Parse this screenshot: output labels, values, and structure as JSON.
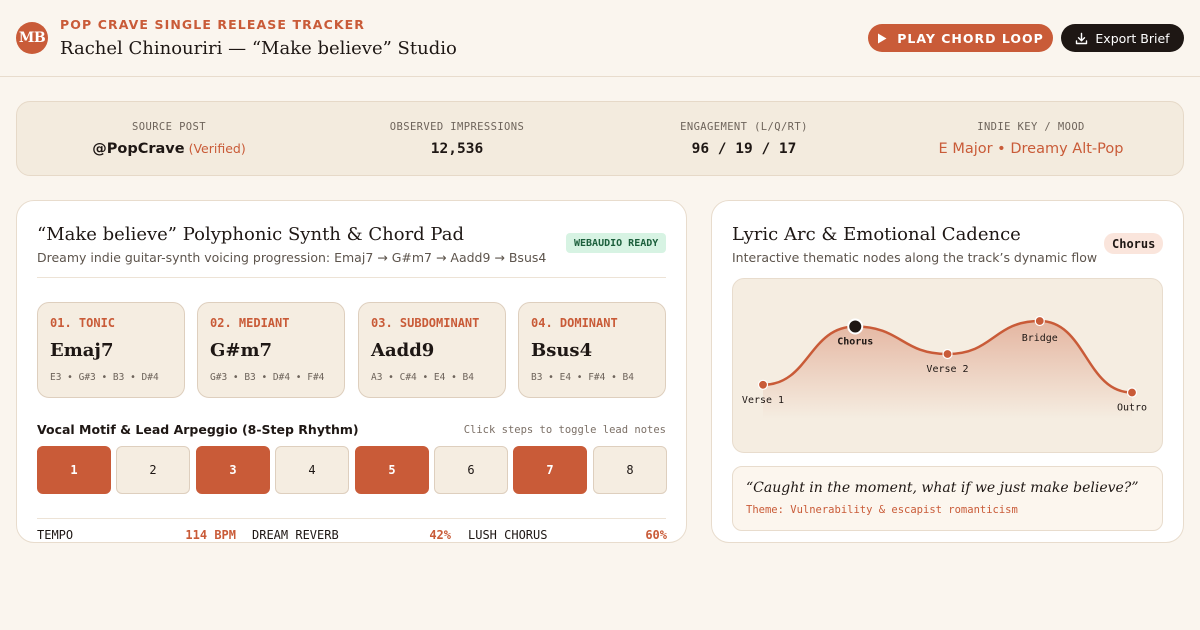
{
  "header": {
    "logo": "MB",
    "eyebrow": "POP CRAVE SINGLE RELEASE TRACKER",
    "title": "Rachel Chinouriri — “Make believe” Studio",
    "play_label": "PLAY CHORD LOOP",
    "play_icon": "play-icon",
    "export_label": "Export Brief",
    "export_icon": "download-icon"
  },
  "stats": [
    {
      "label": "SOURCE POST",
      "value": "@PopCrave",
      "extra": "(Verified)"
    },
    {
      "label": "OBSERVED IMPRESSIONS",
      "value": "12,536"
    },
    {
      "label": "ENGAGEMENT (L/Q/RT)",
      "value": "96 / 19 / 17"
    },
    {
      "label": "INDIE KEY / MOOD",
      "value": "E Major • Dreamy Alt-Pop"
    }
  ],
  "synth": {
    "title": "“Make believe” Polyphonic Synth & Chord Pad",
    "subtitle": "Dreamy indie guitar-synth voicing progression: Emaj7 → G#m7 → Aadd9 → Bsus4",
    "badge": "WEBAUDIO READY",
    "chords": [
      {
        "role": "01. TONIC",
        "name": "Emaj7",
        "notes": "E3 • G#3 • B3 • D#4"
      },
      {
        "role": "02. MEDIANT",
        "name": "G#m7",
        "notes": "G#3 • B3 • D#4 • F#4"
      },
      {
        "role": "03. SUBDOMINANT",
        "name": "Aadd9",
        "notes": "A3 • C#4 • E4 • B4"
      },
      {
        "role": "04. DOMINANT",
        "name": "Bsus4",
        "notes": "B3 • E4 • F#4 • B4"
      }
    ],
    "sequencer": {
      "title": "Vocal Motif & Lead Arpeggio (8-Step Rhythm)",
      "hint": "Click steps to toggle lead notes",
      "steps": [
        {
          "label": "1",
          "active": true
        },
        {
          "label": "2",
          "active": false
        },
        {
          "label": "3",
          "active": true
        },
        {
          "label": "4",
          "active": false
        },
        {
          "label": "5",
          "active": true
        },
        {
          "label": "6",
          "active": false
        },
        {
          "label": "7",
          "active": true
        },
        {
          "label": "8",
          "active": false
        }
      ]
    },
    "params": [
      {
        "label": "TEMPO",
        "value": "114 BPM"
      },
      {
        "label": "DREAM REVERB",
        "value": "42%"
      },
      {
        "label": "LUSH CHORUS",
        "value": "60%"
      }
    ]
  },
  "lyric": {
    "title": "Lyric Arc & Emotional Cadence",
    "subtitle": "Interactive thematic nodes along the track’s dynamic flow",
    "active_section": "Chorus",
    "nodes": [
      {
        "label": "Verse 1",
        "intensity": 0.22,
        "active": false
      },
      {
        "label": "Chorus",
        "intensity": 0.75,
        "active": true
      },
      {
        "label": "Verse 2",
        "intensity": 0.5,
        "active": false
      },
      {
        "label": "Bridge",
        "intensity": 0.8,
        "active": false
      },
      {
        "label": "Outro",
        "intensity": 0.15,
        "active": false
      }
    ],
    "quote": "“Caught in the moment, what if we just make believe?”",
    "theme": "Theme: Vulnerability & escapist romanticism"
  },
  "colors": {
    "accent": "#c95b38",
    "dark": "#1e1714",
    "panel_bg": "#f5ede1",
    "badge_green": "#d7f3e3"
  }
}
